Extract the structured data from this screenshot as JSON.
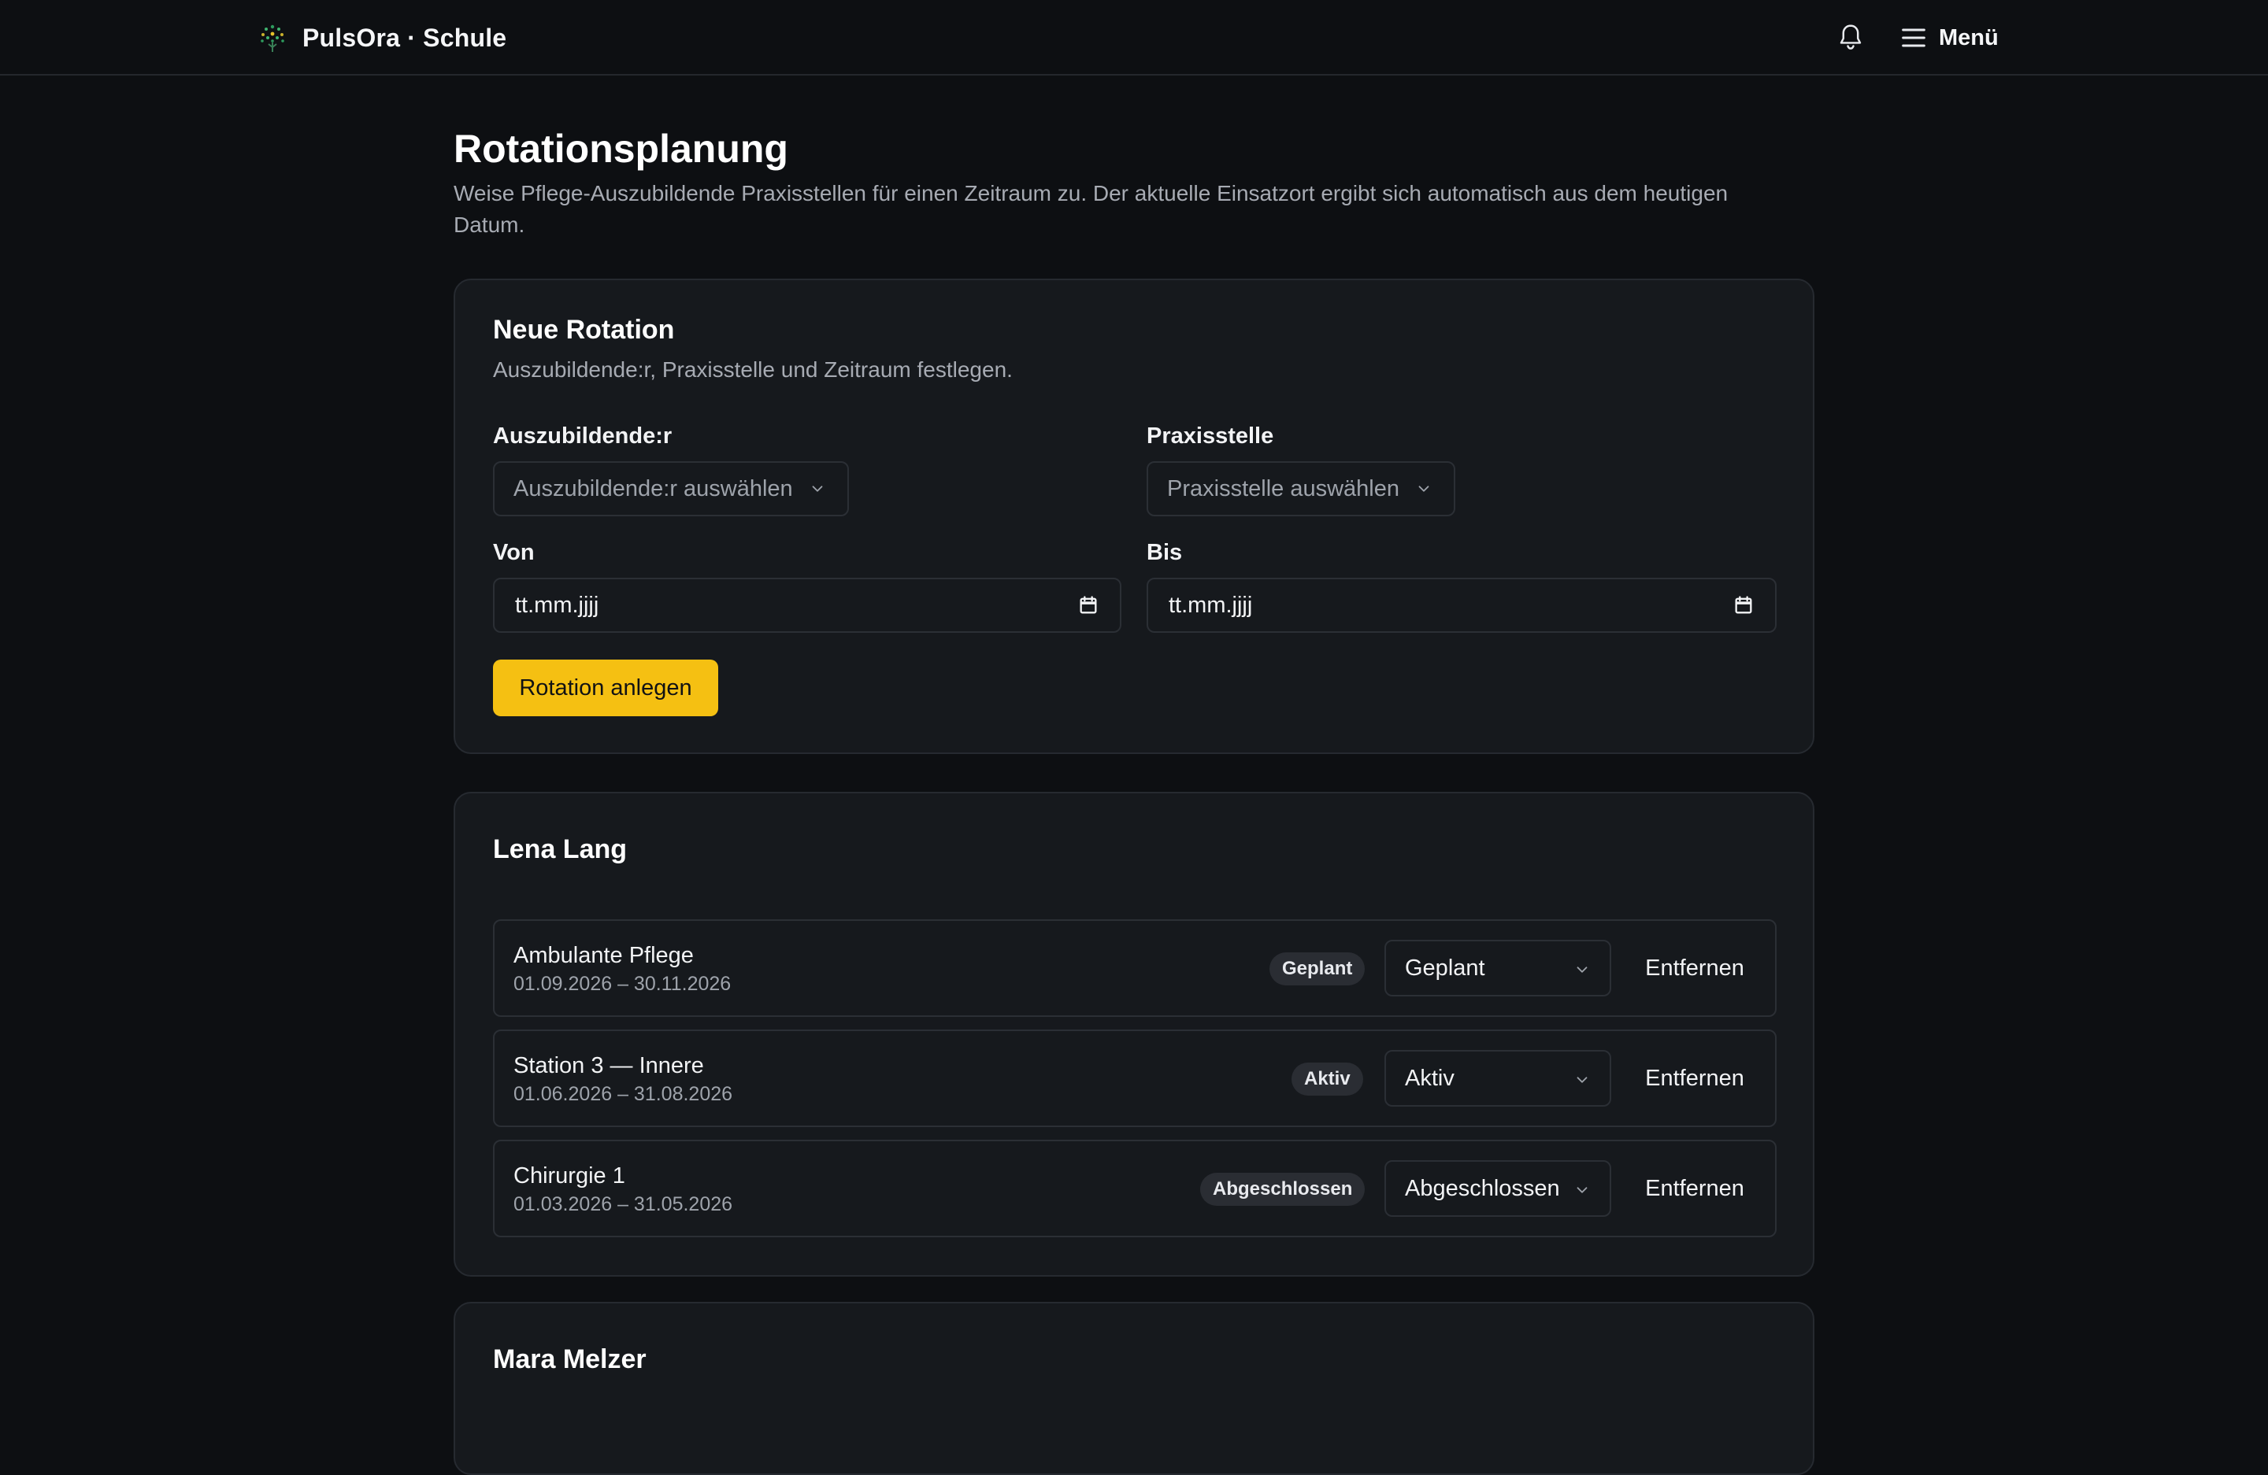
{
  "header": {
    "brand": "PulsOra · Schule",
    "menu_label": "Menü",
    "icons": [
      "leaf-logo-icon",
      "bell-icon",
      "hamburger-icon"
    ]
  },
  "page": {
    "title": "Rotationsplanung",
    "description": "Weise Pflege-Auszubildende Praxisstellen für einen Zeitraum zu. Der aktuelle Einsatzort ergibt sich automatisch aus dem heutigen Datum."
  },
  "new_rotation": {
    "title": "Neue Rotation",
    "subtitle": "Auszubildende:r, Praxisstelle und Zeitraum festlegen.",
    "trainee_label": "Auszubildende:r",
    "trainee_placeholder": "Auszubildende:r auswählen",
    "site_label": "Praxisstelle",
    "site_placeholder": "Praxisstelle auswählen",
    "from_label": "Von",
    "from_value": "tt.mm.jjjj",
    "to_label": "Bis",
    "to_value": "tt.mm.jjjj",
    "submit_label": "Rotation anlegen"
  },
  "groups": [
    {
      "trainee": "Lena Lang",
      "rotations": [
        {
          "site": "Ambulante Pflege",
          "dates": "01.09.2026 – 30.11.2026",
          "badge": "Geplant",
          "status": "Geplant",
          "remove": "Entfernen"
        },
        {
          "site": "Station 3 — Innere",
          "dates": "01.06.2026 – 31.08.2026",
          "badge": "Aktiv",
          "status": "Aktiv",
          "remove": "Entfernen"
        },
        {
          "site": "Chirurgie 1",
          "dates": "01.03.2026 – 31.05.2026",
          "badge": "Abgeschlossen",
          "status": "Abgeschlossen",
          "remove": "Entfernen"
        }
      ]
    },
    {
      "trainee": "Mara Melzer",
      "rotations": []
    }
  ],
  "colors": {
    "accent": "#f5c012",
    "background": "#0d0f12",
    "card": "#16191d"
  }
}
